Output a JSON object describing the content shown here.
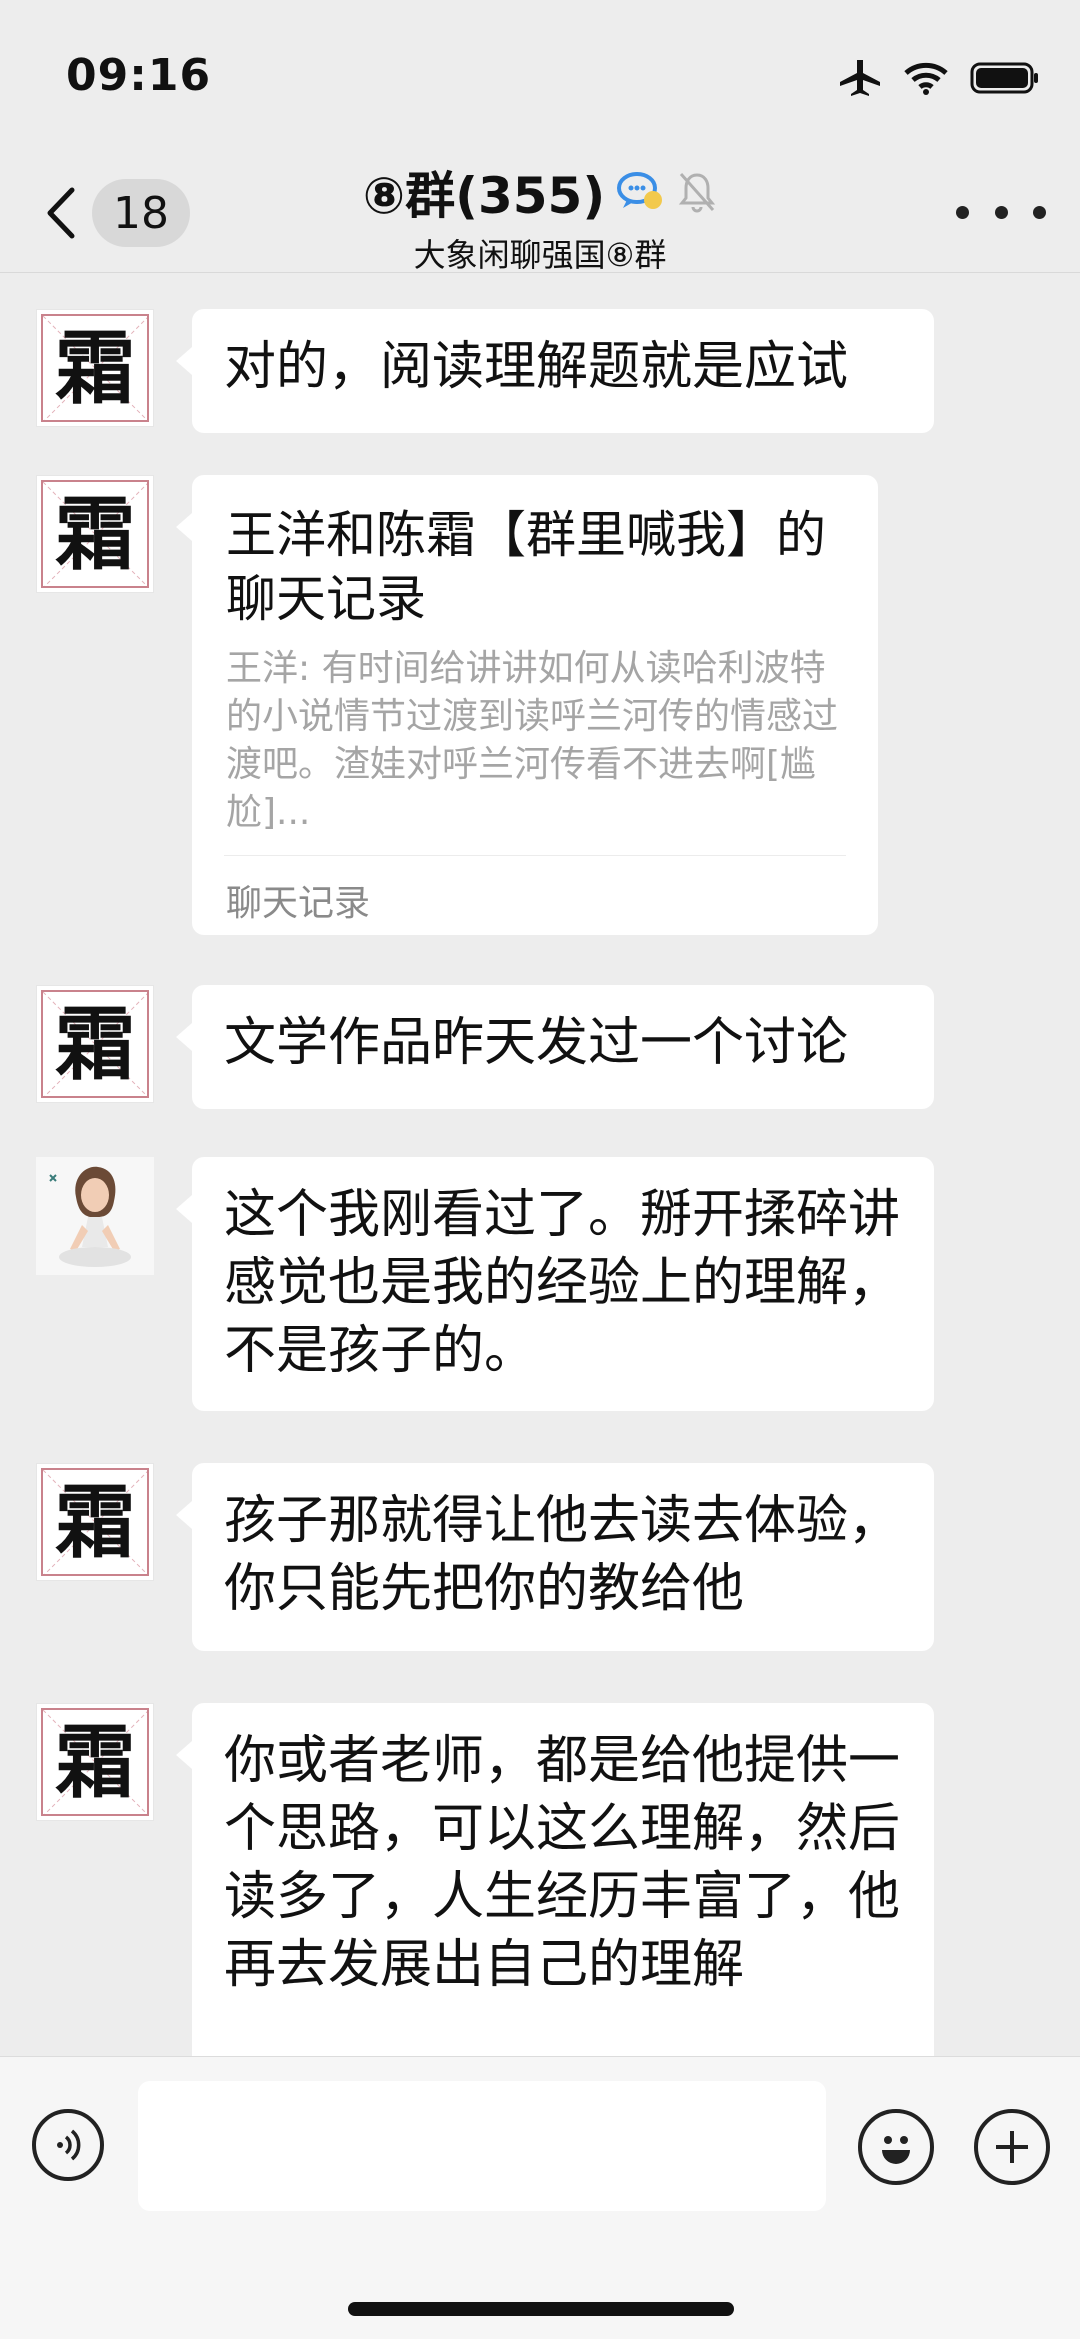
{
  "status_bar": {
    "time": "09:16",
    "icons": [
      "airplane-icon",
      "wifi-icon",
      "battery-icon"
    ]
  },
  "nav": {
    "back_count": "18",
    "title": "⑧群(355)",
    "subtitle": "大象闲聊强国⑧群",
    "icons": [
      "chevron-left-icon",
      "chat-bubbles-icon",
      "mute-bell-icon",
      "more-icon"
    ]
  },
  "messages": [
    {
      "avatar_char": "霜",
      "text": "对的，阅读理解题就是应试"
    },
    {
      "avatar_char": "霜",
      "card_title": "王洋和陈霜【群里喊我】的聊天记录",
      "card_preview": "王洋: 有时间给讲讲如何从读哈利波特的小说情节过渡到读呼兰河传的情感过渡吧。渣娃对呼兰河传看不进去啊[尴尬]...",
      "card_footer": "聊天记录"
    },
    {
      "avatar_char": "霜",
      "text": "文学作品昨天发过一个讨论"
    },
    {
      "text": "这个我刚看过了。掰开揉碎讲感觉也是我的经验上的理解，不是孩子的。"
    },
    {
      "avatar_char": "霜",
      "text": "孩子那就得让他去读去体验，你只能先把你的教给他"
    },
    {
      "avatar_char": "霜",
      "text": "你或者老师，都是给他提供一个思路，可以这么理解，然后读多了，人生经历丰富了，他再去发展出自己的理解"
    }
  ],
  "input_bar": {
    "icons": [
      "voice-icon",
      "emoji-icon",
      "plus-icon"
    ]
  }
}
